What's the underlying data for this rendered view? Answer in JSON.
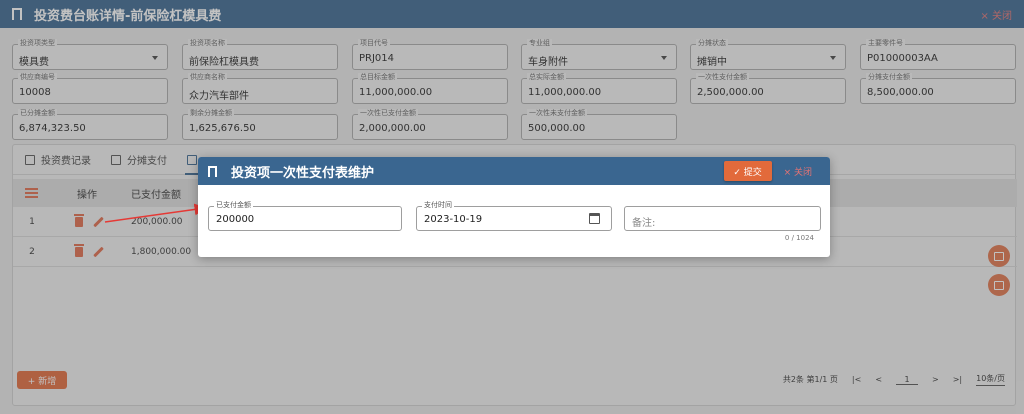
{
  "page": {
    "title": "投资费台账详情-前保险杠模具费",
    "close_label": "× 关闭"
  },
  "fields": [
    {
      "label": "投资项类型",
      "value": "模具费",
      "dropdown": true
    },
    {
      "label": "投资项名称",
      "value": "前保险杠模具费",
      "dropdown": false
    },
    {
      "label": "项目代号",
      "value": "PRJ014",
      "dropdown": false
    },
    {
      "label": "专业组",
      "value": "车身附件",
      "dropdown": true
    },
    {
      "label": "分摊状态",
      "value": "摊销中",
      "dropdown": true
    },
    {
      "label": "主要零件号",
      "value": "P01000003AA",
      "dropdown": false
    },
    {
      "label": "供应商编号",
      "value": "10008",
      "dropdown": false
    },
    {
      "label": "供应商名称",
      "value": "众力汽车部件",
      "dropdown": false
    },
    {
      "label": "总目标金额",
      "value": "11,000,000.00",
      "dropdown": false
    },
    {
      "label": "总实际金额",
      "value": "11,000,000.00",
      "dropdown": false
    },
    {
      "label": "一次性支付金额",
      "value": "2,500,000.00",
      "dropdown": false
    },
    {
      "label": "分摊支付金额",
      "value": "8,500,000.00",
      "dropdown": false
    },
    {
      "label": "已分摊金额",
      "value": "6,874,323.50",
      "dropdown": false
    },
    {
      "label": "剩余分摊金额",
      "value": "1,625,676.50",
      "dropdown": false
    },
    {
      "label": "一次性已支付金额",
      "value": "2,000,000.00",
      "dropdown": false
    },
    {
      "label": "一次性未支付金额",
      "value": "500,000.00",
      "dropdown": false
    }
  ],
  "tabs": [
    {
      "label": "投资费记录"
    },
    {
      "label": "分摊支付"
    },
    {
      "label": ""
    }
  ],
  "table": {
    "headers": {
      "op": "操作",
      "amount": "已支付金额"
    },
    "rows": [
      {
        "index": "1",
        "amount": "200,000.00"
      },
      {
        "index": "2",
        "amount": "1,800,000.00"
      }
    ]
  },
  "footer": {
    "add_label": "+ 新增",
    "total_text": "共2条 第1/1 页",
    "first": "|<",
    "prev": "<",
    "page": "1",
    "next": ">",
    "last": ">|",
    "page_size": "10条/页"
  },
  "modal": {
    "title": "投资项一次性支付表维护",
    "submit_label": "✓ 提交",
    "close_label": "× 关闭",
    "paid_amount": {
      "label": "已支付金额",
      "value": "200000"
    },
    "pay_time": {
      "label": "支付时间",
      "value": "2023-10-19"
    },
    "remark": {
      "placeholder": "备注:",
      "counter": "0 / 1024"
    }
  },
  "colors": {
    "header_blue": "#3a6690",
    "accent_orange": "#e26a3b",
    "close_red": "#e57373"
  }
}
